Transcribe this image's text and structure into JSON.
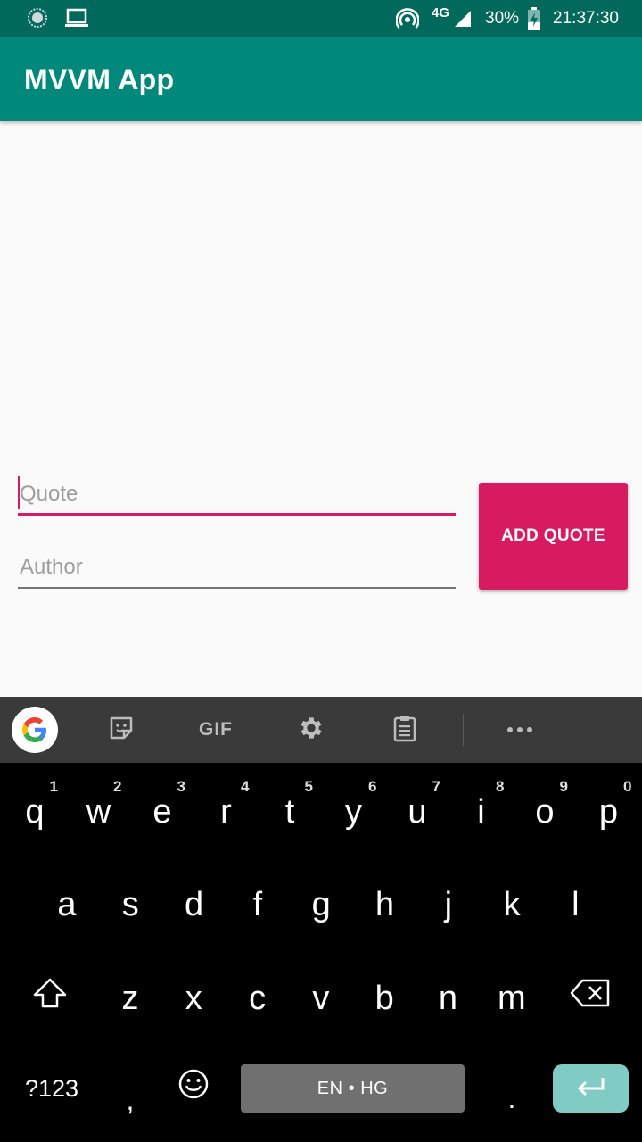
{
  "status_bar": {
    "network": "4G",
    "battery": "30%",
    "time": "21:37:30"
  },
  "app_bar": {
    "title": "MVVM App"
  },
  "form": {
    "quote_placeholder": "Quote",
    "author_placeholder": "Author",
    "add_button_label": "ADD QUOTE"
  },
  "keyboard": {
    "toolbar": {
      "gif_label": "GIF"
    },
    "row1": [
      {
        "ch": "q",
        "hint": "1"
      },
      {
        "ch": "w",
        "hint": "2"
      },
      {
        "ch": "e",
        "hint": "3"
      },
      {
        "ch": "r",
        "hint": "4"
      },
      {
        "ch": "t",
        "hint": "5"
      },
      {
        "ch": "y",
        "hint": "6"
      },
      {
        "ch": "u",
        "hint": "7"
      },
      {
        "ch": "i",
        "hint": "8"
      },
      {
        "ch": "o",
        "hint": "9"
      },
      {
        "ch": "p",
        "hint": "0"
      }
    ],
    "row2": [
      "a",
      "s",
      "d",
      "f",
      "g",
      "h",
      "j",
      "k",
      "l"
    ],
    "row3": [
      "z",
      "x",
      "c",
      "v",
      "b",
      "n",
      "m"
    ],
    "symbols_label": "?123",
    "comma": ",",
    "space_label": "EN • HG",
    "period": "."
  },
  "colors": {
    "status_bar": "#00695c",
    "app_bar": "#00897b",
    "accent": "#d81b60",
    "enter_key": "#80cbc4"
  }
}
